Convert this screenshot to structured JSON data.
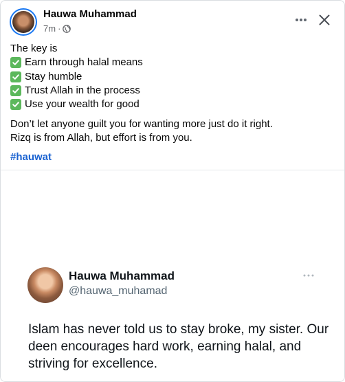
{
  "post": {
    "author": "Hauwa Muhammad",
    "time": "7m",
    "separator": "·",
    "intro": "The key is",
    "checklist": [
      "Earn through halal means",
      "Stay humble",
      "Trust Allah in the process",
      "Use your wealth for good"
    ],
    "paragraph_line1": "Don’t let anyone guilt you for wanting more just do it right.",
    "paragraph_line2": "Rizq is from Allah, but effort is from you.",
    "hashtag": "#hauwat"
  },
  "embed": {
    "name": "Hauwa Muhammad",
    "handle": "@hauwa_muhamad",
    "text": "Islam has never told us to stay broke, my sister. Our deen encourages hard work, earning halal, and striving for excellence."
  },
  "icons": {
    "privacy": "globe-icon",
    "more": "more-horizontal-icon",
    "close": "close-icon",
    "check": "check-box-icon"
  },
  "colors": {
    "accent": "#1877f2",
    "hashtag": "#1b63d1",
    "check": "#5cb85c",
    "secondary_text": "#65676b"
  }
}
